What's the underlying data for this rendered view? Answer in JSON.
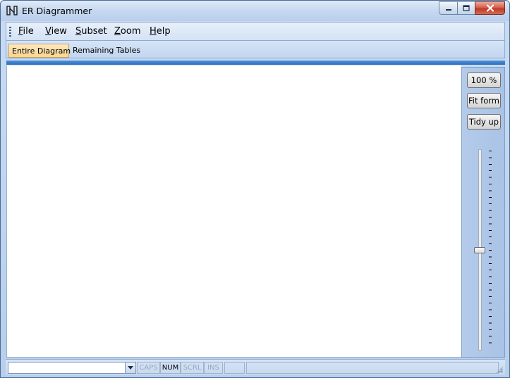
{
  "window": {
    "title": "ER Diagrammer",
    "app_icon": "er-diagram-icon",
    "controls": {
      "minimize_icon": "minimize-icon",
      "maximize_icon": "maximize-icon",
      "close_icon": "close-icon"
    }
  },
  "menubar": {
    "items": [
      {
        "label": "File"
      },
      {
        "label": "View"
      },
      {
        "label": "Subset"
      },
      {
        "label": "Zoom"
      },
      {
        "label": "Help"
      }
    ]
  },
  "tabs": [
    {
      "label": "Entire Diagram",
      "active": true
    },
    {
      "label": "Remaining Tables",
      "active": false
    }
  ],
  "toolpanel": {
    "zoom_button": "100 %",
    "fit_button": "Fit form",
    "tidy_button": "Tidy up",
    "zoom_slider_position": 0.5
  },
  "statusbar": {
    "combo_value": "",
    "indicators": [
      {
        "label": "CAPS",
        "active": false
      },
      {
        "label": "NUM",
        "active": true
      },
      {
        "label": "SCRL",
        "active": false
      },
      {
        "label": "INS",
        "active": false
      }
    ]
  },
  "colors": {
    "accent_blue": "#2f6fbd",
    "active_tab": "#fbd68f",
    "panel": "#b4cbea"
  }
}
